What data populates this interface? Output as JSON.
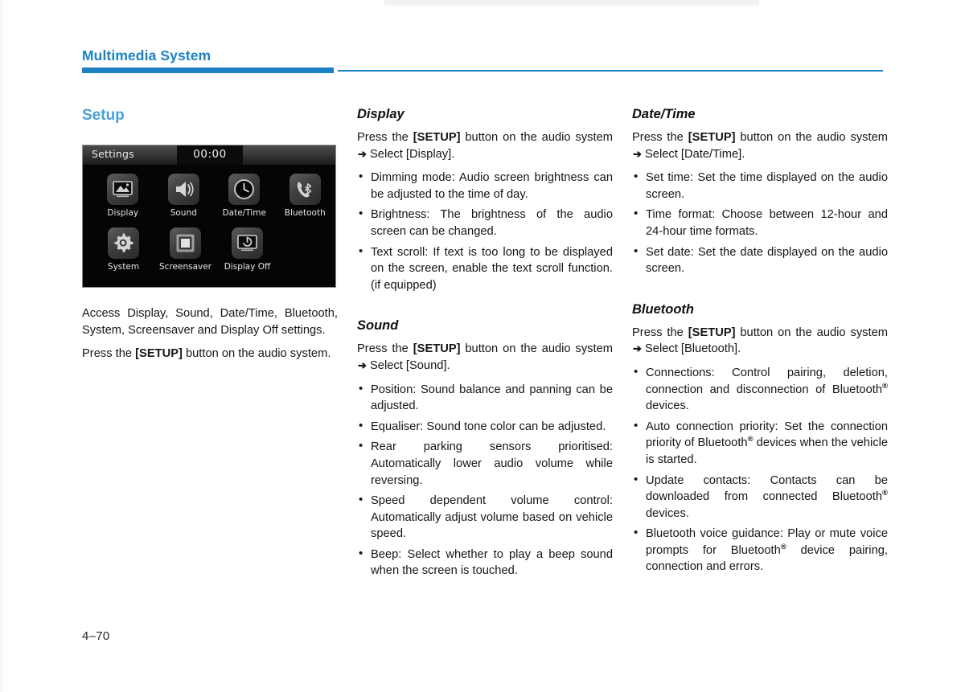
{
  "page": {
    "running_header": "Multimedia System",
    "folio": "4–70",
    "accent_color": "#1a82c4",
    "heading_color": "#4a9fd6"
  },
  "device_screenshot": {
    "title": "Settings",
    "clock": "00:00",
    "tiles": [
      {
        "label": "Display",
        "icon": "picture-icon"
      },
      {
        "label": "Sound",
        "icon": "speaker-icon"
      },
      {
        "label": "Date/Time",
        "icon": "clock-icon"
      },
      {
        "label": "Bluetooth",
        "icon": "bluetooth-phone-icon"
      },
      {
        "label": "System",
        "icon": "gear-icon"
      },
      {
        "label": "Screensaver",
        "icon": "screensaver-icon"
      },
      {
        "label": "Display Off",
        "icon": "display-off-icon"
      }
    ]
  },
  "columns": {
    "left": {
      "heading": "Setup",
      "para1": "Access Display, Sound, Date/Time, Bluetooth, System, Screensaver and Display Off settings.",
      "para2_pre": "Press the ",
      "para2_bold": "[SETUP]",
      "para2_post": " button on the audio system."
    },
    "display": {
      "heading": "Display",
      "intro_pre": "Press the ",
      "intro_bold": "[SETUP]",
      "intro_mid": " button on the audio system ",
      "intro_arrow": "➔",
      "intro_post": " Select [Display].",
      "bullets": [
        "Dimming mode: Audio screen brightness can be adjusted to the time of day.",
        "Brightness: The brightness of the audio screen can be changed.",
        "Text scroll: If text is too long to be displayed on the screen, enable the text scroll function. (if equipped)"
      ]
    },
    "sound": {
      "heading": "Sound",
      "intro_pre": "Press the ",
      "intro_bold": "[SETUP]",
      "intro_mid": " button on the audio system ",
      "intro_arrow": "➔",
      "intro_post": " Select [Sound].",
      "bullets": [
        "Position: Sound balance and panning can be adjusted.",
        "Equaliser: Sound tone color can be adjusted.",
        "Rear parking sensors prioritised: Automatically lower audio volume while reversing.",
        "Speed dependent volume control: Automatically adjust volume based on vehicle speed.",
        "Beep: Select whether to play a beep sound when the screen is touched."
      ]
    },
    "datetime": {
      "heading": "Date/Time",
      "intro_pre": "Press the ",
      "intro_bold": "[SETUP]",
      "intro_mid": " button on the audio system ",
      "intro_arrow": "➔",
      "intro_post": " Select [Date/Time].",
      "bullets": [
        "Set time: Set the time displayed on the audio screen.",
        "Time format: Choose between 12-hour and 24-hour time formats.",
        "Set date: Set the date displayed on the audio screen."
      ]
    },
    "bluetooth": {
      "heading": "Bluetooth",
      "intro_pre": "Press the ",
      "intro_bold": "[SETUP]",
      "intro_mid": " button on the audio system ",
      "intro_arrow": "➔",
      "intro_post": " Select [Bluetooth].",
      "bullets": [
        {
          "part1": "Connections: Control pairing, deletion, connection and disconnection of Bluetooth",
          "reg": "®",
          "part2": " devices."
        },
        {
          "part1": "Auto connection priority: Set the connection priority of Bluetooth",
          "reg": "®",
          "part2": " devices when the vehicle is started."
        },
        {
          "part1": "Update contacts: Contacts can be downloaded from connected Bluetooth",
          "reg": "®",
          "part2": " devices."
        },
        {
          "part1": "Bluetooth voice guidance: Play or mute voice prompts for Bluetooth",
          "reg": "®",
          "part2": " device pairing, connection and errors."
        }
      ]
    }
  }
}
